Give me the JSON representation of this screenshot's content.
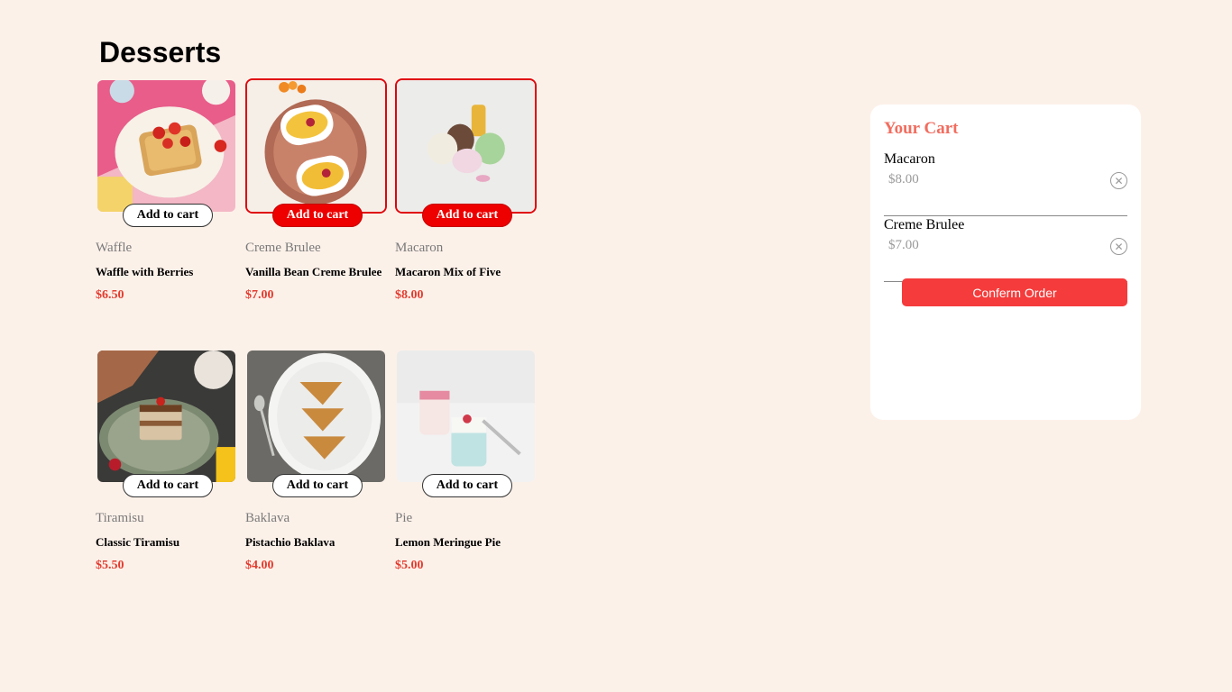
{
  "page": {
    "title": "Desserts"
  },
  "products": [
    {
      "category": "Waffle",
      "name": "Waffle with Berries",
      "price": "$6.50",
      "button": "Add to cart",
      "in_cart": false,
      "image": "waffle-image"
    },
    {
      "category": "Creme Brulee",
      "name": "Vanilla Bean Creme Brulee",
      "price": "$7.00",
      "button": "Add to cart",
      "in_cart": true,
      "image": "creme-brulee-image"
    },
    {
      "category": "Macaron",
      "name": "Macaron Mix of Five",
      "price": "$8.00",
      "button": "Add to cart",
      "in_cart": true,
      "image": "macaron-image"
    },
    {
      "category": "Tiramisu",
      "name": "Classic Tiramisu",
      "price": "$5.50",
      "button": "Add to cart",
      "in_cart": false,
      "image": "tiramisu-image"
    },
    {
      "category": "Baklava",
      "name": "Pistachio Baklava",
      "price": "$4.00",
      "button": "Add to cart",
      "in_cart": false,
      "image": "baklava-image"
    },
    {
      "category": "Pie",
      "name": "Lemon Meringue Pie",
      "price": "$5.00",
      "button": "Add to cart",
      "in_cart": false,
      "image": "pie-image"
    }
  ],
  "cart": {
    "title": "Your Cart",
    "items": [
      {
        "name": "Macaron",
        "price": "$8.00",
        "remove_icon": "close-circle-icon"
      },
      {
        "name": "Creme Brulee",
        "price": "$7.00",
        "remove_icon": "close-circle-icon"
      }
    ],
    "confirm_label": "Conferm Order"
  },
  "colors": {
    "background": "#fcf1e9",
    "accent_red": "#ee0000",
    "price_red": "#e33b2f",
    "cart_title": "#f16d5f",
    "confirm_button": "#f53b3b"
  }
}
